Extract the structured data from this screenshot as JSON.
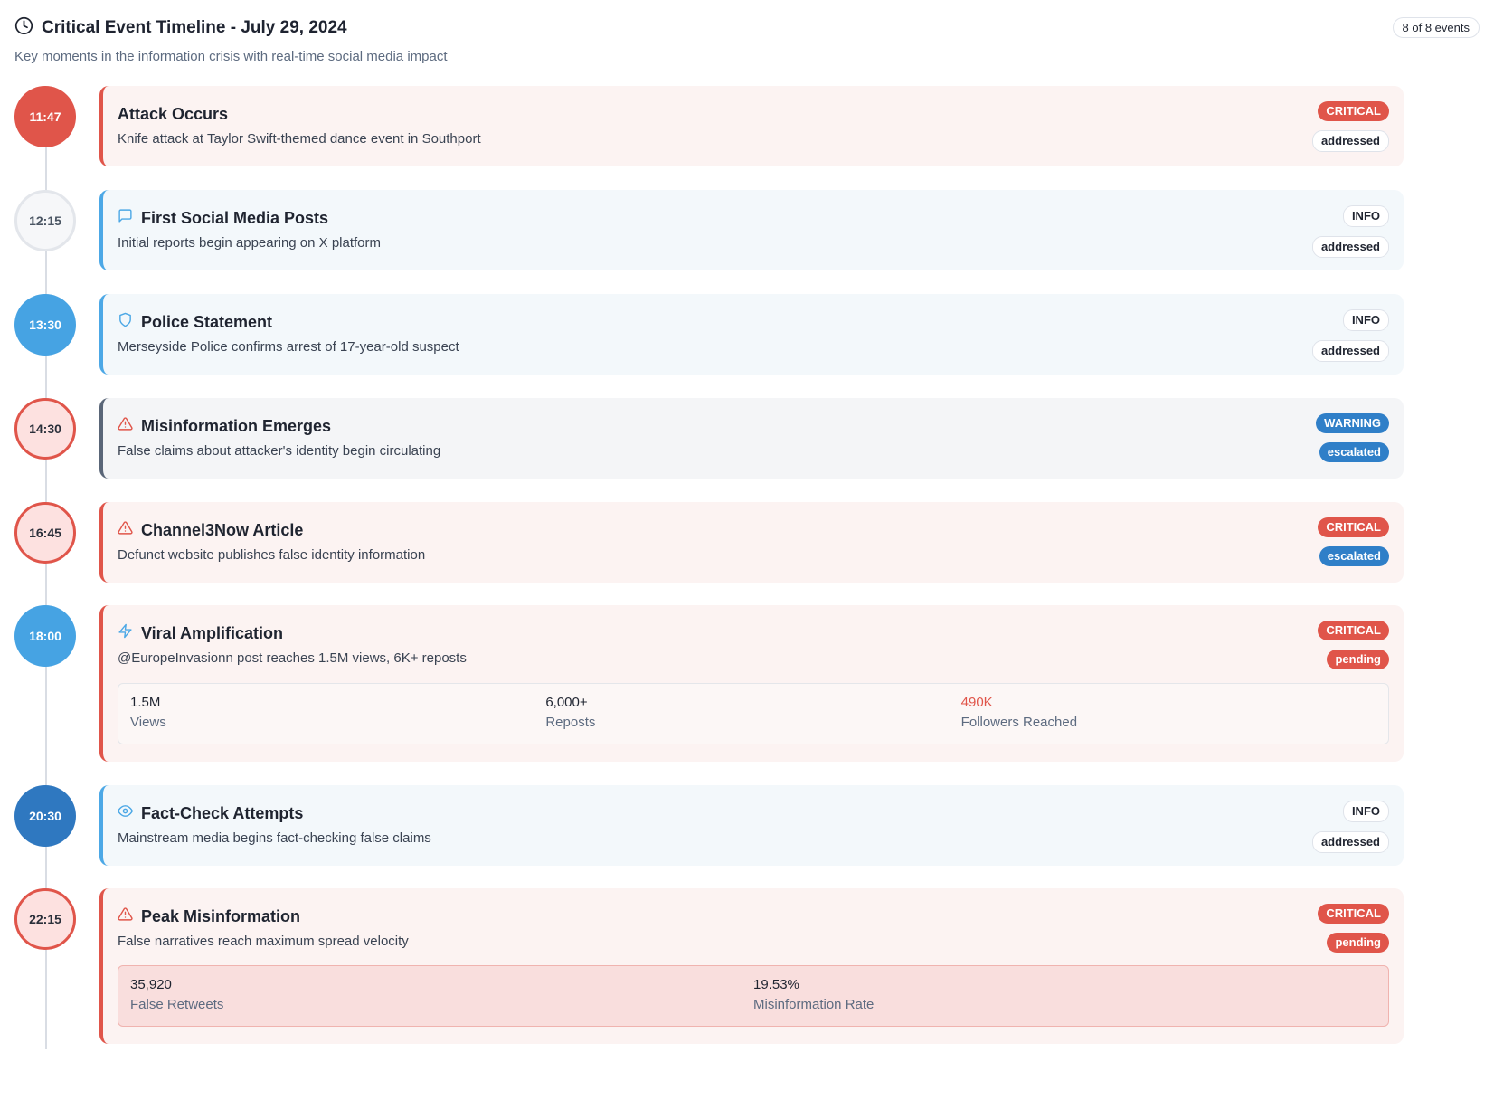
{
  "header": {
    "title": "Critical Event Timeline - July 29, 2024",
    "subtitle": "Key moments in the information crisis with real-time social media impact",
    "count": "8 of 8 events",
    "icon": "clock-icon"
  },
  "colors": {
    "critical": "#e0554a",
    "info_accent": "#4ca8e6",
    "warning": "#2f7fc8"
  },
  "events": [
    {
      "time": "11:47",
      "title": "Attack Occurs",
      "description": "Knife attack at Taylor Swift-themed dance event in Southport",
      "severity": "CRITICAL",
      "status": "addressed",
      "icon": ""
    },
    {
      "time": "12:15",
      "title": "First Social Media Posts",
      "description": "Initial reports begin appearing on X platform",
      "severity": "INFO",
      "status": "addressed",
      "icon": "message-icon"
    },
    {
      "time": "13:30",
      "title": "Police Statement",
      "description": "Merseyside Police confirms arrest of 17-year-old suspect",
      "severity": "INFO",
      "status": "addressed",
      "icon": "shield-icon"
    },
    {
      "time": "14:30",
      "title": "Misinformation Emerges",
      "description": "False claims about attacker's identity begin circulating",
      "severity": "WARNING",
      "status": "escalated",
      "icon": "warning-icon"
    },
    {
      "time": "16:45",
      "title": "Channel3Now Article",
      "description": "Defunct website publishes false identity information",
      "severity": "CRITICAL",
      "status": "escalated",
      "icon": "warning-icon"
    },
    {
      "time": "18:00",
      "title": "Viral Amplification",
      "description": "@EuropeInvasionn post reaches 1.5M views, 6K+ reposts",
      "severity": "CRITICAL",
      "status": "pending",
      "icon": "lightning-icon",
      "metrics": [
        {
          "value": "1.5M",
          "label": "Views"
        },
        {
          "value": "6,000+",
          "label": "Reposts"
        },
        {
          "value": "490K",
          "label": "Followers Reached"
        }
      ]
    },
    {
      "time": "20:30",
      "title": "Fact-Check Attempts",
      "description": "Mainstream media begins fact-checking false claims",
      "severity": "INFO",
      "status": "addressed",
      "icon": "eye-icon"
    },
    {
      "time": "22:15",
      "title": "Peak Misinformation",
      "description": "False narratives reach maximum spread velocity",
      "severity": "CRITICAL",
      "status": "pending",
      "icon": "warning-icon",
      "metrics": [
        {
          "value": "35,920",
          "label": "False Retweets"
        },
        {
          "value": "19.53%",
          "label": "Misinformation Rate"
        }
      ]
    }
  ]
}
